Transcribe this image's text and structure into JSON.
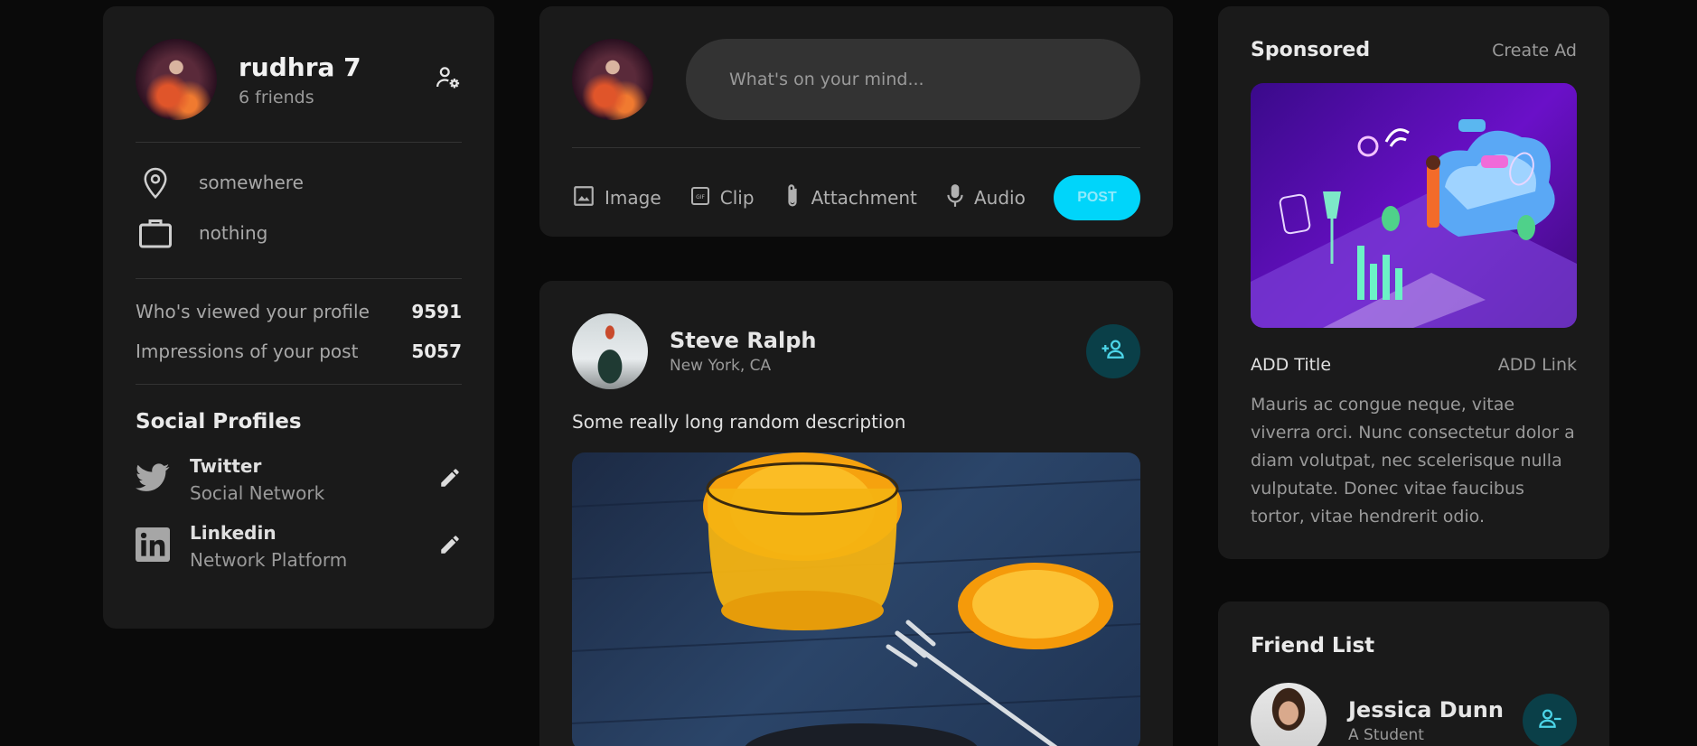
{
  "user": {
    "name": "rudhra 7",
    "friends": "6 friends",
    "location": "somewhere",
    "occupation": "nothing",
    "stats": [
      {
        "label": "Who's viewed your profile",
        "value": "9591"
      },
      {
        "label": "Impressions of your post",
        "value": "5057"
      }
    ],
    "social_title": "Social Profiles",
    "socials": [
      {
        "name": "Twitter",
        "sub": "Social Network",
        "icon": "twitter-icon"
      },
      {
        "name": "Linkedin",
        "sub": "Network Platform",
        "icon": "linkedin-icon"
      }
    ]
  },
  "composer": {
    "placeholder": "What's on your mind...",
    "tools": [
      {
        "label": "Image",
        "icon": "image-icon"
      },
      {
        "label": "Clip",
        "icon": "gif-icon"
      },
      {
        "label": "Attachment",
        "icon": "paperclip-icon"
      },
      {
        "label": "Audio",
        "icon": "microphone-icon"
      }
    ],
    "post_label": "POST"
  },
  "feed": {
    "author": "Steve Ralph",
    "location": "New York, CA",
    "description": "Some really long random description"
  },
  "sponsored": {
    "title": "Sponsored",
    "create": "Create Ad",
    "ad_title": "ADD Title",
    "ad_link": "ADD Link",
    "body": "Mauris ac congue neque, vitae viverra orci. Nunc consectetur dolor a diam volutpat, nec scelerisque nulla vulputate. Donec vitae faucibus tortor, vitae hendrerit odio."
  },
  "friends": {
    "title": "Friend List",
    "items": [
      {
        "name": "Jessica Dunn",
        "sub": "A Student"
      }
    ]
  },
  "colors": {
    "accent": "#00d5fa",
    "card": "#1a1a1a",
    "background": "#0a0a0a"
  }
}
